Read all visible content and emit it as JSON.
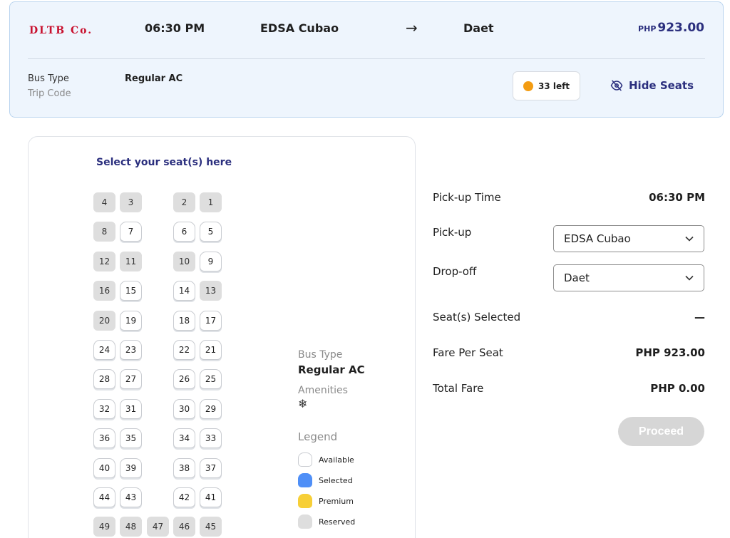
{
  "trip": {
    "operator": "DLTB Co.",
    "time": "06:30 PM",
    "origin": "EDSA Cubao",
    "arrow": "→",
    "destination": "Daet",
    "currency": "PHP",
    "price": "923.00",
    "bus_type_label": "Bus Type",
    "trip_code_label": "Trip Code",
    "bus_type": "Regular AC",
    "seats_left": "33 left",
    "hide_seats": "Hide Seats"
  },
  "seat_map": {
    "title": "Select your seat(s) here",
    "rows": [
      [
        {
          "n": "4",
          "s": "reserved"
        },
        {
          "n": "3",
          "s": "reserved"
        },
        {
          "n": "2",
          "s": "reserved"
        },
        {
          "n": "1",
          "s": "reserved"
        }
      ],
      [
        {
          "n": "8",
          "s": "reserved"
        },
        {
          "n": "7",
          "s": "available"
        },
        {
          "n": "6",
          "s": "available"
        },
        {
          "n": "5",
          "s": "available"
        }
      ],
      [
        {
          "n": "12",
          "s": "reserved"
        },
        {
          "n": "11",
          "s": "reserved"
        },
        {
          "n": "10",
          "s": "reserved"
        },
        {
          "n": "9",
          "s": "available"
        }
      ],
      [
        {
          "n": "16",
          "s": "reserved"
        },
        {
          "n": "15",
          "s": "available"
        },
        {
          "n": "14",
          "s": "available"
        },
        {
          "n": "13",
          "s": "reserved"
        }
      ],
      [
        {
          "n": "20",
          "s": "reserved"
        },
        {
          "n": "19",
          "s": "available"
        },
        {
          "n": "18",
          "s": "available"
        },
        {
          "n": "17",
          "s": "available"
        }
      ],
      [
        {
          "n": "24",
          "s": "available"
        },
        {
          "n": "23",
          "s": "available"
        },
        {
          "n": "22",
          "s": "available"
        },
        {
          "n": "21",
          "s": "available"
        }
      ],
      [
        {
          "n": "28",
          "s": "available"
        },
        {
          "n": "27",
          "s": "available"
        },
        {
          "n": "26",
          "s": "available"
        },
        {
          "n": "25",
          "s": "available"
        }
      ],
      [
        {
          "n": "32",
          "s": "available"
        },
        {
          "n": "31",
          "s": "available"
        },
        {
          "n": "30",
          "s": "available"
        },
        {
          "n": "29",
          "s": "available"
        }
      ],
      [
        {
          "n": "36",
          "s": "available"
        },
        {
          "n": "35",
          "s": "available"
        },
        {
          "n": "34",
          "s": "available"
        },
        {
          "n": "33",
          "s": "available"
        }
      ],
      [
        {
          "n": "40",
          "s": "available"
        },
        {
          "n": "39",
          "s": "available"
        },
        {
          "n": "38",
          "s": "available"
        },
        {
          "n": "37",
          "s": "available"
        }
      ],
      [
        {
          "n": "44",
          "s": "available"
        },
        {
          "n": "43",
          "s": "available"
        },
        {
          "n": "42",
          "s": "available"
        },
        {
          "n": "41",
          "s": "available"
        }
      ]
    ],
    "back_row": [
      {
        "n": "49",
        "s": "reserved"
      },
      {
        "n": "48",
        "s": "reserved"
      },
      {
        "n": "47",
        "s": "reserved"
      },
      {
        "n": "46",
        "s": "reserved"
      },
      {
        "n": "45",
        "s": "reserved"
      }
    ]
  },
  "bus_info": {
    "bus_type_label": "Bus Type",
    "bus_type": "Regular AC",
    "amenities_label": "Amenities",
    "amenity_icon": "snowflake-icon",
    "amenity_glyph": "❄",
    "legend_label": "Legend",
    "legend": [
      "Available",
      "Selected",
      "Premium",
      "Reserved"
    ]
  },
  "summary": {
    "pickup_time_label": "Pick-up Time",
    "pickup_time": "06:30 PM",
    "pickup_label": "Pick-up",
    "pickup_value": "EDSA Cubao",
    "dropoff_label": "Drop-off",
    "dropoff_value": "Daet",
    "seats_selected_label": "Seat(s) Selected",
    "seats_selected": "—",
    "fare_per_seat_label": "Fare Per Seat",
    "fare_per_seat": "PHP 923.00",
    "total_fare_label": "Total Fare",
    "total_fare": "PHP 0.00",
    "proceed": "Proceed"
  },
  "colors": {
    "brand_red": "#c8102e",
    "accent_navy": "#2b2f7e",
    "seats_left_dot": "#f39c12",
    "selected": "#4f8ff7",
    "premium": "#f7cf37",
    "reserved": "#dedede"
  }
}
